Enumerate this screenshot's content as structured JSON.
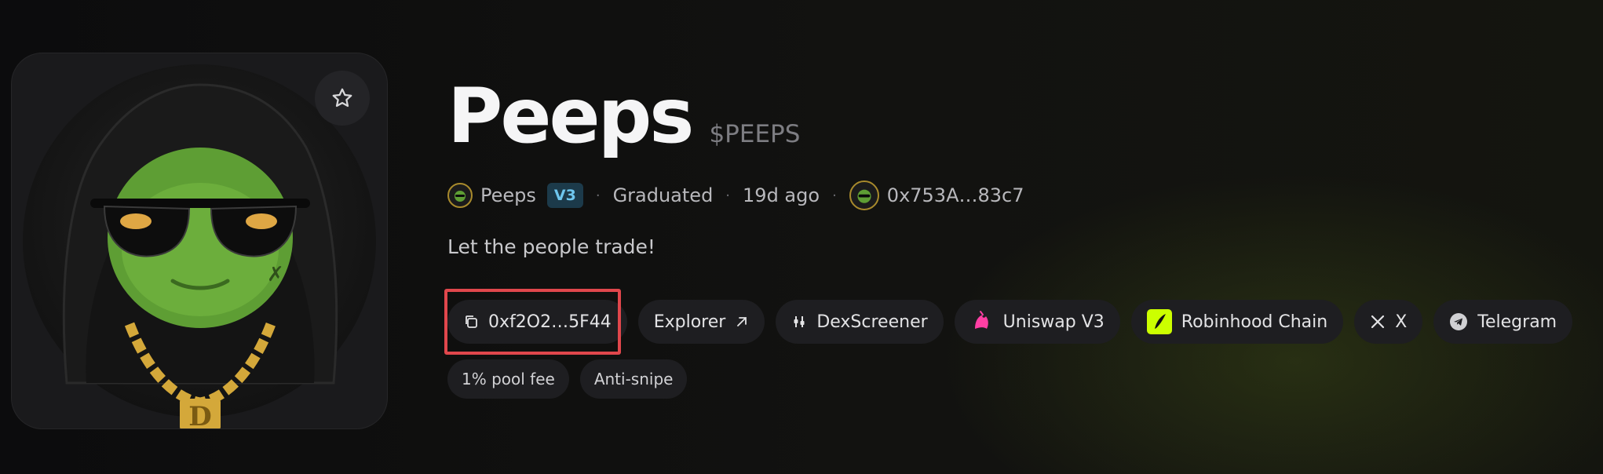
{
  "token": {
    "name": "Peeps",
    "ticker": "$PEEPS",
    "image_alt": "green frog mascot in black hoodie with sunglasses and gold D chain"
  },
  "meta": {
    "creator_name": "Peeps",
    "version_badge": "V3",
    "status": "Graduated",
    "age": "19d ago",
    "deployer_address": "0x753A…83c7"
  },
  "tagline": "Let the people trade!",
  "links": [
    {
      "label": "0xf2O2…5F44",
      "icon": "copy-icon",
      "highlighted": true
    },
    {
      "label": "Explorer",
      "icon": "external-arrow-icon"
    },
    {
      "label": "DexScreener",
      "icon": "dexscreener-icon"
    },
    {
      "label": "Uniswap V3",
      "icon": "uniswap-unicorn-icon"
    },
    {
      "label": "Robinhood Chain",
      "icon": "robinhood-feather-icon"
    },
    {
      "label": "X",
      "icon": "x-logo-icon"
    },
    {
      "label": "Telegram",
      "icon": "telegram-icon"
    }
  ],
  "tags": [
    "1% pool fee",
    "Anti-snipe"
  ],
  "colors": {
    "accent_highlight": "#e0474c",
    "v3_badge_bg": "#1c3a4a",
    "v3_badge_text": "#6ec6ee",
    "uniswap_pink": "#ff3fa4",
    "robinhood_green": "#ccff00",
    "chip_bg": "#1e1e21"
  }
}
